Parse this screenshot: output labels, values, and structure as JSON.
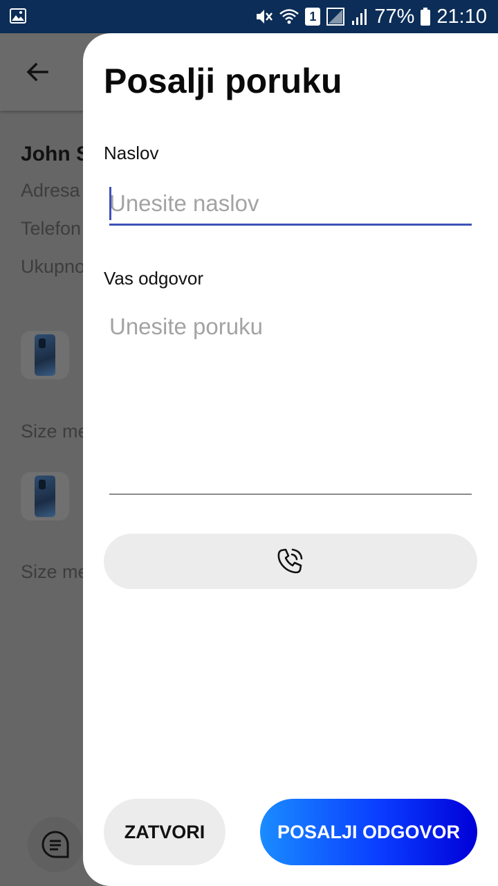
{
  "status_bar": {
    "battery_percent": "77%",
    "time": "21:10",
    "sim_slot": "1",
    "icons": [
      "gallery-icon",
      "mute-icon",
      "wifi-icon",
      "sim-icon",
      "no-signal-icon",
      "signal-icon",
      "battery-icon"
    ]
  },
  "background": {
    "customer_name": "John S",
    "lines": [
      "Adresa",
      "Telefon",
      "Ukupno"
    ],
    "items": [
      {
        "caption": "Size me"
      },
      {
        "caption": "Size me"
      }
    ]
  },
  "sheet": {
    "title": "Posalji poruku",
    "subject_label": "Naslov",
    "subject_placeholder": "Unesite naslov",
    "subject_value": "",
    "message_label": "Vas odgovor",
    "message_placeholder": "Unesite poruku",
    "message_value": "",
    "call_icon": "phone-call-icon",
    "close_label": "ZATVORI",
    "send_label": "POSALJI ODGOVOR"
  },
  "colors": {
    "status_bar": "#0b2d57",
    "accent": "#3f51b5",
    "send_gradient_start": "#1a8cff",
    "send_gradient_end": "#0000d8",
    "scrim": "#666666"
  }
}
